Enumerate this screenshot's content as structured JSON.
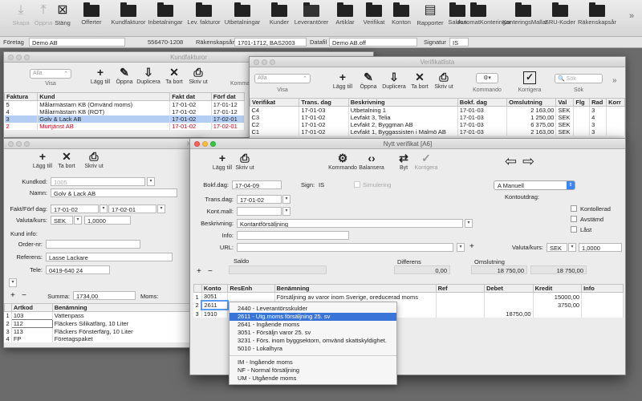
{
  "main_toolbar": {
    "buttons": [
      {
        "label": "Skapa",
        "icon": "download-icon",
        "dim": true
      },
      {
        "label": "Öppna",
        "icon": "upload-icon",
        "dim": true
      },
      {
        "label": "Stäng",
        "icon": "close-doc-icon",
        "dim": false
      },
      {
        "label": "Offerter",
        "icon": "folder-icon"
      },
      {
        "label": "Kundfakturor",
        "icon": "folder-icon"
      },
      {
        "label": "Inbetalningar",
        "icon": "folder-icon"
      },
      {
        "label": "Lev. fakturor",
        "icon": "folder-icon"
      },
      {
        "label": "Utbetalningar",
        "icon": "folder-icon"
      },
      {
        "label": "Kunder",
        "icon": "folder-icon"
      },
      {
        "label": "Leverantörer",
        "icon": "folder-open-icon"
      },
      {
        "label": "Artiklar",
        "icon": "folder-icon"
      },
      {
        "label": "Verifikat",
        "icon": "folder-icon"
      },
      {
        "label": "Konton",
        "icon": "folder-icon"
      },
      {
        "label": "Rapporter",
        "icon": "document-icon"
      },
      {
        "label": "Saldon",
        "icon": "folder-icon"
      },
      {
        "label": "AutomatKonteringar",
        "icon": "folder-icon"
      },
      {
        "label": "KonteringsMallar",
        "icon": "folder-icon"
      },
      {
        "label": "SRU-Koder",
        "icon": "folder-icon"
      },
      {
        "label": "Räkenskapsår",
        "icon": "folder-icon"
      }
    ],
    "overflow": "»"
  },
  "info_bar": {
    "foretag_label": "Företag",
    "foretag_value": "Demo AB",
    "orgnr": "556470-1208",
    "rakenskapsar_label": "Räkenskapsår",
    "rakenskapsar_value": "1701-1712, BAS2003",
    "datafil_label": "Datafil",
    "datafil_value": "Demo AB.off",
    "signatur_label": "Signatur",
    "signatur_value": "IS"
  },
  "kundfakturor": {
    "title": "Kundfakturor",
    "filter": "Alla",
    "visa": "Visa",
    "tools": [
      "Lägg till",
      "Öppna",
      "Duplicera",
      "Ta bort",
      "Skriv ut"
    ],
    "kommando": "Kommando",
    "columns": [
      "Faktura",
      "Kund",
      "Fakt dat",
      "Förf dat"
    ],
    "rows": [
      {
        "faktura": "5",
        "kund": "Målarmästarn KB (Omvänd moms)",
        "fakt": "17-01-02",
        "forf": "17-01-12",
        "state": ""
      },
      {
        "faktura": "4",
        "kund": "Målarmästarn KB (ROT)",
        "fakt": "17-01-02",
        "forf": "17-01-12",
        "state": ""
      },
      {
        "faktura": "3",
        "kund": "Golv & Lack AB",
        "fakt": "17-01-02",
        "forf": "17-02-01",
        "state": "sel"
      },
      {
        "faktura": "2",
        "kund": "Murtjänst AB",
        "fakt": "17-01-02",
        "forf": "17-02-01",
        "state": "red"
      }
    ]
  },
  "verifikatlista": {
    "title": "Verifikatlista",
    "filter": "Alla",
    "visa": "Visa",
    "tools": [
      "Lägg till",
      "Öppna",
      "Duplicera",
      "Ta bort",
      "Skriv ut"
    ],
    "kommando": "Kommando",
    "korrigera": "Korrigera",
    "search_placeholder": "Sök",
    "sok": "Sök",
    "columns": [
      "Verifikat",
      "Trans. dag",
      "Beskrivning",
      "Bokf. dag",
      "Omslutning",
      "Val",
      "Flg",
      "Rad",
      "Korr"
    ],
    "rows": [
      {
        "ver": "C4",
        "trans": "17-01-03",
        "besk": "Utbetalning 1",
        "bokf": "17-01-03",
        "oms": "2 163,00",
        "val": "SEK",
        "flg": "",
        "rad": "3",
        "korr": ""
      },
      {
        "ver": "C3",
        "trans": "17-01-02",
        "besk": "Levfakt 3, Telia",
        "bokf": "17-01-03",
        "oms": "1 250,00",
        "val": "SEK",
        "flg": "",
        "rad": "4",
        "korr": ""
      },
      {
        "ver": "C2",
        "trans": "17-01-02",
        "besk": "Levfakt 2, Byggman AB",
        "bokf": "17-01-03",
        "oms": "6 375,00",
        "val": "SEK",
        "flg": "",
        "rad": "3",
        "korr": ""
      },
      {
        "ver": "C1",
        "trans": "17-01-02",
        "besk": "Levfakt 1, Byggassisten i Malmö AB",
        "bokf": "17-01-03",
        "oms": "2 163,00",
        "val": "SEK",
        "flg": "",
        "rad": "3",
        "korr": ""
      }
    ]
  },
  "kundfaktura": {
    "title": "K",
    "tools": [
      "Lägg till",
      "Ta bort",
      "Skriv ut"
    ],
    "kundkod_label": "Kundkod:",
    "kundkod": "1005",
    "namn_label": "Namn:",
    "namn": "Golv & Lack AB",
    "fakt_label": "Fakt/Förf dag:",
    "fakt": "17-01-02",
    "forf": "17-02-01",
    "valuta_label": "Valuta/kurs:",
    "valuta": "SEK",
    "kurs": "1,0000",
    "kundinfo_label": "Kund info:",
    "order_label": "Order-nr:",
    "order": "",
    "referens_label": "Referens:",
    "referens": "Lasse Lackare",
    "tele_label": "Tele:",
    "tele": "0419-640 24",
    "summa_label": "Summa:",
    "summa": "1734,00",
    "moms_label": "Moms:",
    "columns": [
      "Artkod",
      "Benämning"
    ],
    "rows": [
      {
        "n": "1",
        "kod": "103",
        "ben": "Vattenpass"
      },
      {
        "n": "2",
        "kod": "112",
        "ben": "Fläckers Silikatfärg, 10 Liter"
      },
      {
        "n": "3",
        "kod": "113",
        "ben": "Fläckers Fönsterfärg, 10 Liter"
      },
      {
        "n": "4",
        "kod": "FP",
        "ben": "Företagspaket"
      }
    ]
  },
  "nytt_verifikat": {
    "title": "Nytt verifikat [A6]",
    "tools": [
      "Lägg till",
      "Skriv ut",
      "Kommando",
      "Balansera",
      "Byt",
      "Korrigera"
    ],
    "bokf_label": "Bokf.dag:",
    "bokf": "17-04-09",
    "sign_label": "Sign:",
    "sign": "IS",
    "simulering": "Simulering",
    "serie": "A Manuell",
    "kontoutdrag": "Kontoutdrag:",
    "kontoll": "Kontollerad",
    "avstamd": "Avstämd",
    "last": "Låst",
    "trans_label": "Trans.dag:",
    "trans": "17-01-02",
    "mall_label": "Kont.mall:",
    "mall": "",
    "besk_label": "Beskrivning:",
    "besk": "Kontantförsäljning",
    "info_label": "Info:",
    "info": "",
    "url_label": "URL:",
    "url": "",
    "valuta_label": "Valuta/kurs:",
    "valuta": "SEK",
    "kurs": "1,0000",
    "saldo_label": "Saldo",
    "differens_label": "Differens",
    "omslutning_label": "Omslutning",
    "differens": "0,00",
    "oms_debet": "18 750,00",
    "oms_kredit": "18 750,00",
    "columns": [
      "Konto",
      "ResEnh",
      "Benämning",
      "Ref",
      "Debet",
      "Kredit",
      "Info"
    ],
    "rows": [
      {
        "n": "1",
        "konto": "3051",
        "ben": "Försäljning av varor inom Sverige, oreducerad moms",
        "debet": "",
        "kredit": "15000,00"
      },
      {
        "n": "2",
        "konto": "2611",
        "ben": "",
        "debet": "",
        "kredit": "3750,00"
      },
      {
        "n": "3",
        "konto": "1910",
        "ben": "",
        "debet": "18750,00",
        "kredit": ""
      }
    ]
  },
  "account_popup": {
    "options": [
      "2440 - Leverantörsskulder",
      "2611 - Utg.moms försäljning 25. sv",
      "2641 - Ingående moms",
      "3051 - Försäljn varor 25. sv",
      "3231 - Förs. inom byggsektorn, omvänd skattskyldighet.",
      "5010 - Lokalhyra"
    ],
    "vat_options": [
      "IM - Ingående moms",
      "NF - Normal försäljning",
      "UM - Utgående moms"
    ],
    "selected": 1
  }
}
